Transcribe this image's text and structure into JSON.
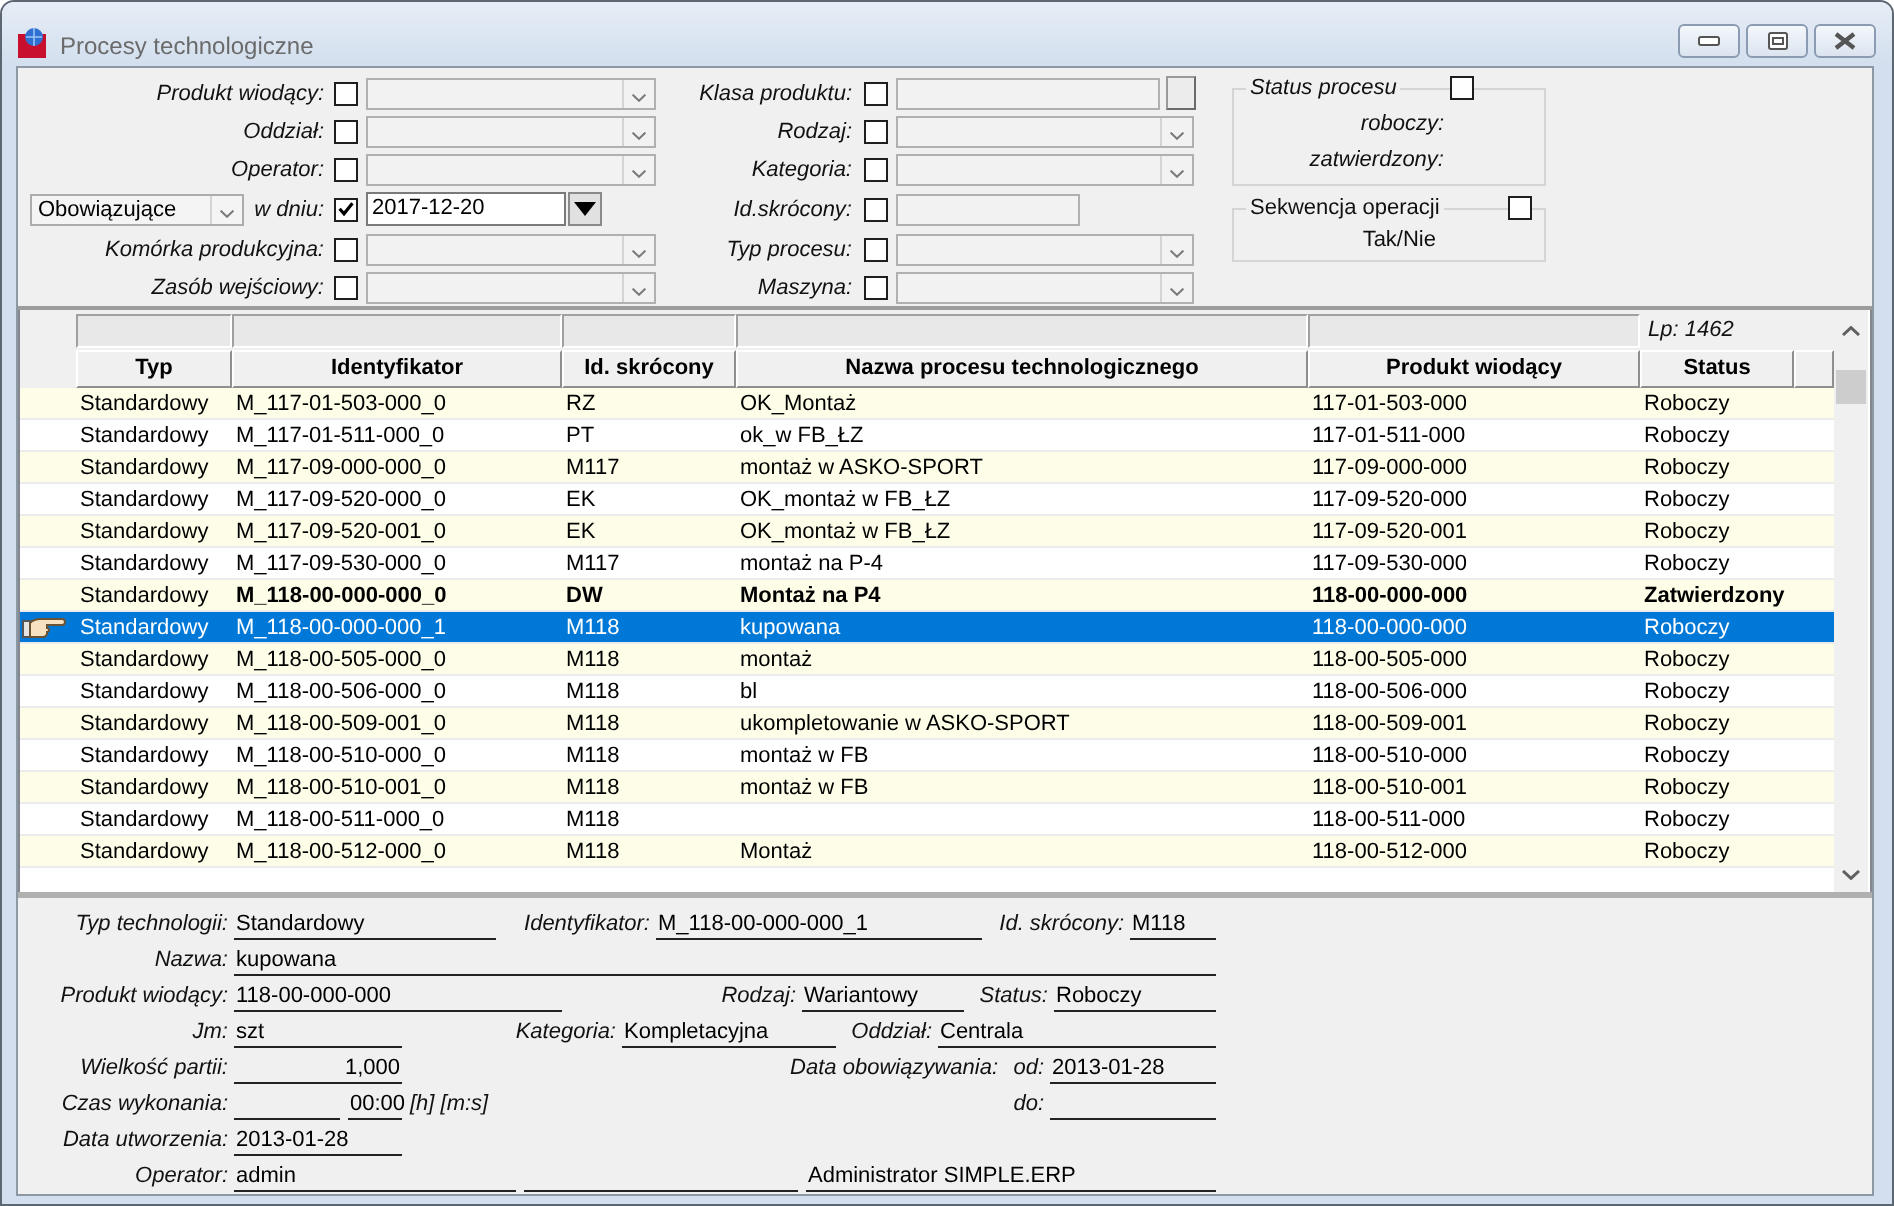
{
  "window": {
    "title": "Procesy technologiczne"
  },
  "filters": {
    "left": [
      {
        "kind": "combo",
        "label": "Produkt wiodący:",
        "checked": false
      },
      {
        "kind": "combo",
        "label": "Oddział:",
        "checked": false
      },
      {
        "kind": "combo",
        "label": "Operator:",
        "checked": false
      },
      {
        "kind": "date",
        "selector": "Obowiązujące",
        "label": "w dniu:",
        "checked": true,
        "value": "2017-12-20"
      },
      {
        "kind": "combo",
        "label": "Komórka produkcyjna:",
        "checked": false
      },
      {
        "kind": "combo",
        "label": "Zasób wejściowy:",
        "checked": false
      }
    ],
    "middle": [
      {
        "kind": "picker",
        "label": "Klasa produktu:",
        "checked": false
      },
      {
        "kind": "combo",
        "label": "Rodzaj:",
        "checked": false
      },
      {
        "kind": "combo",
        "label": "Kategoria:",
        "checked": false
      },
      {
        "kind": "text",
        "label": "Id.skrócony:",
        "checked": false
      },
      {
        "kind": "combo",
        "label": "Typ procesu:",
        "checked": false
      },
      {
        "kind": "combo",
        "label": "Maszyna:",
        "checked": false
      }
    ],
    "groups": [
      {
        "title": "Status procesu",
        "checked": false,
        "options": [
          "roboczy:",
          "zatwierdzony:"
        ]
      },
      {
        "title": "Sekwencja operacji",
        "checked": false,
        "options": [
          "Tak/Nie"
        ]
      }
    ]
  },
  "table": {
    "record_count": "Lp: 1462",
    "columns": [
      "Typ",
      "Identyfikator",
      "Id. skrócony",
      "Nazwa procesu technologicznego",
      "Produkt wiodący",
      "Status"
    ],
    "rows": [
      {
        "type": "Standardowy",
        "identifier": "M_117-01-503-000_0",
        "short_id": "RZ",
        "name": "OK_Montaż",
        "lead_product": "117-01-503-000",
        "status": "Roboczy",
        "selected": false,
        "bold": false
      },
      {
        "type": "Standardowy",
        "identifier": "M_117-01-511-000_0",
        "short_id": "PT",
        "name": "ok_w FB_ŁZ",
        "lead_product": "117-01-511-000",
        "status": "Roboczy",
        "selected": false,
        "bold": false
      },
      {
        "type": "Standardowy",
        "identifier": "M_117-09-000-000_0",
        "short_id": "M117",
        "name": "montaż w ASKO-SPORT",
        "lead_product": "117-09-000-000",
        "status": "Roboczy",
        "selected": false,
        "bold": false
      },
      {
        "type": "Standardowy",
        "identifier": "M_117-09-520-000_0",
        "short_id": "EK",
        "name": "OK_montaż w FB_ŁZ",
        "lead_product": "117-09-520-000",
        "status": "Roboczy",
        "selected": false,
        "bold": false
      },
      {
        "type": "Standardowy",
        "identifier": "M_117-09-520-001_0",
        "short_id": "EK",
        "name": "OK_montaż w FB_ŁZ",
        "lead_product": "117-09-520-001",
        "status": "Roboczy",
        "selected": false,
        "bold": false
      },
      {
        "type": "Standardowy",
        "identifier": "M_117-09-530-000_0",
        "short_id": "M117",
        "name": "montaż na P-4",
        "lead_product": "117-09-530-000",
        "status": "Roboczy",
        "selected": false,
        "bold": false
      },
      {
        "type": "Standardowy",
        "identifier": "M_118-00-000-000_0",
        "short_id": "DW",
        "name": "Montaż na P4",
        "lead_product": "118-00-000-000",
        "status": "Zatwierdzony",
        "selected": false,
        "bold": true
      },
      {
        "type": "Standardowy",
        "identifier": "M_118-00-000-000_1",
        "short_id": "M118",
        "name": "kupowana",
        "lead_product": "118-00-000-000",
        "status": "Roboczy",
        "selected": true,
        "bold": false
      },
      {
        "type": "Standardowy",
        "identifier": "M_118-00-505-000_0",
        "short_id": "M118",
        "name": "montaż",
        "lead_product": "118-00-505-000",
        "status": "Roboczy",
        "selected": false,
        "bold": false
      },
      {
        "type": "Standardowy",
        "identifier": "M_118-00-506-000_0",
        "short_id": "M118",
        "name": "bl",
        "lead_product": "118-00-506-000",
        "status": "Roboczy",
        "selected": false,
        "bold": false
      },
      {
        "type": "Standardowy",
        "identifier": "M_118-00-509-001_0",
        "short_id": "M118",
        "name": "ukompletowanie w ASKO-SPORT",
        "lead_product": "118-00-509-001",
        "status": "Roboczy",
        "selected": false,
        "bold": false
      },
      {
        "type": "Standardowy",
        "identifier": "M_118-00-510-000_0",
        "short_id": "M118",
        "name": "montaż w FB",
        "lead_product": "118-00-510-000",
        "status": "Roboczy",
        "selected": false,
        "bold": false
      },
      {
        "type": "Standardowy",
        "identifier": "M_118-00-510-001_0",
        "short_id": "M118",
        "name": "montaż w FB",
        "lead_product": "118-00-510-001",
        "status": "Roboczy",
        "selected": false,
        "bold": false
      },
      {
        "type": "Standardowy",
        "identifier": "M_118-00-511-000_0",
        "short_id": "M118",
        "lead_product": "118-00-511-000",
        "status": "Roboczy",
        "selected": false,
        "bold": false
      },
      {
        "type": "Standardowy",
        "identifier": "M_118-00-512-000_0",
        "short_id": "M118",
        "name": "Montaż",
        "lead_product": "118-00-512-000",
        "status": "Roboczy",
        "selected": false,
        "bold": false
      }
    ]
  },
  "details": {
    "rows": [
      [
        {
          "kind": "field",
          "label": "Typ technologii:",
          "value": "Standardowy"
        },
        {
          "kind": "field",
          "label": "Identyfikator:",
          "value": "M_118-00-000-000_1"
        },
        {
          "kind": "field",
          "label": "Id. skrócony:",
          "value": "M118"
        }
      ],
      [
        {
          "kind": "field",
          "label": "Nazwa:",
          "value": "kupowana"
        }
      ],
      [
        {
          "kind": "field",
          "label": "Produkt wiodący:",
          "value": "118-00-000-000"
        },
        {
          "kind": "field",
          "label": "Rodzaj:",
          "value": "Wariantowy"
        },
        {
          "kind": "field",
          "label": "Status:",
          "value": "Roboczy"
        }
      ],
      [
        {
          "kind": "field",
          "label": "Jm:",
          "value": "szt"
        },
        {
          "kind": "field",
          "label": "Kategoria:",
          "value": "Kompletacyjna"
        },
        {
          "kind": "field",
          "label": "Oddział:",
          "value": "Centrala"
        }
      ],
      [
        {
          "kind": "field",
          "label": "Wielkość partii:",
          "value": "1,000"
        },
        {
          "kind": "label",
          "label": "Data obowiązywania:"
        },
        {
          "kind": "field",
          "label": "od:",
          "value": "2013-01-28"
        }
      ],
      [
        {
          "kind": "field",
          "label": "Czas wykonania:"
        },
        {
          "kind": "field",
          "value": "00:00"
        },
        {
          "kind": "unit",
          "text": "[h] [m:s]"
        },
        {
          "kind": "field",
          "label": "do:"
        }
      ],
      [
        {
          "kind": "field",
          "label": "Data utworzenia:",
          "value": "2013-01-28"
        }
      ],
      [
        {
          "kind": "field",
          "label": "Operator:",
          "value": "admin"
        },
        {
          "kind": "field"
        },
        {
          "kind": "field",
          "value": "Administrator SIMPLE.ERP"
        }
      ]
    ]
  }
}
